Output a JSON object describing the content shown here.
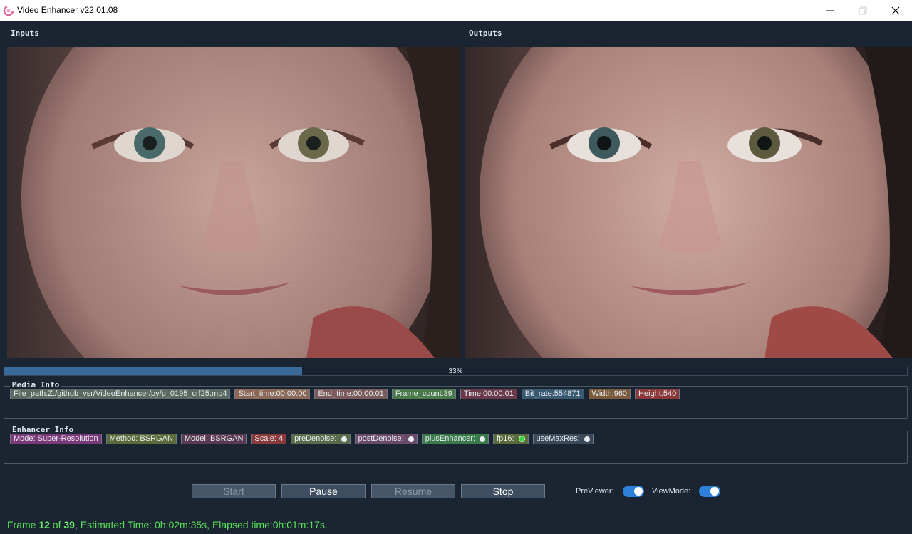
{
  "window": {
    "title": "Video Enhancer v22.01.08",
    "controls": {
      "minimize": "—",
      "maximize": "❐",
      "close": "✕"
    }
  },
  "panels": {
    "inputs_label": "Inputs",
    "outputs_label": "Outputs"
  },
  "progress": {
    "label": "33%",
    "fraction": 0.33
  },
  "media_info": {
    "title": "Media Info",
    "tags": [
      {
        "text": "File_path:Z:/github_vsr/VideoEnhancer/py/p_0195_crf25.mp4",
        "color": "#5a6a62"
      },
      {
        "text": "Start_time:00:00:00",
        "color": "#8c6858"
      },
      {
        "text": "End_time:00:00:01",
        "color": "#7a5a5a"
      },
      {
        "text": "Frame_count:39",
        "color": "#4a7a4a"
      },
      {
        "text": "Time:00:00:01",
        "color": "#6a3a4a"
      },
      {
        "text": "Bit_rate:554871",
        "color": "#3a5a72"
      },
      {
        "text": "Width:960",
        "color": "#7a5a3a"
      },
      {
        "text": "Height:540",
        "color": "#8a3a3a"
      }
    ]
  },
  "enhancer_info": {
    "title": "Enhancer Info",
    "tags": [
      {
        "text": "Mode: Super-Resolution",
        "color": "#7a3a7a",
        "dot": null
      },
      {
        "text": "Method: BSRGAN",
        "color": "#5a6a3a",
        "dot": null
      },
      {
        "text": "Model: BSRGAN",
        "color": "#5a3a52",
        "dot": null
      },
      {
        "text": "Scale: 4",
        "color": "#8a3a3a",
        "dot": null
      },
      {
        "text": "preDenoise:",
        "color": "#5a6a4a",
        "dot": "off"
      },
      {
        "text": "postDenoise:",
        "color": "#6a4a6a",
        "dot": "off"
      },
      {
        "text": "plusEnhancer:",
        "color": "#3a7a4a",
        "dot": "off"
      },
      {
        "text": "fp16:",
        "color": "#5a6a3a",
        "dot": "on"
      },
      {
        "text": "useMaxRes:",
        "color": "#3a4a5a",
        "dot": "off"
      }
    ]
  },
  "buttons": {
    "start": "Start",
    "pause": "Pause",
    "resume": "Resume",
    "stop": "Stop"
  },
  "toggles": {
    "previewer_label": "PreViewer:",
    "previewer_on": true,
    "viewmode_label": "ViewMode:",
    "viewmode_on": true
  },
  "status": {
    "frame_prefix": "Frame ",
    "frame_current": "12",
    "frame_of": " of ",
    "frame_total": "39",
    "rest": ", Estimated Time: 0h:02m:35s, Elapsed time:0h:01m:17s."
  }
}
